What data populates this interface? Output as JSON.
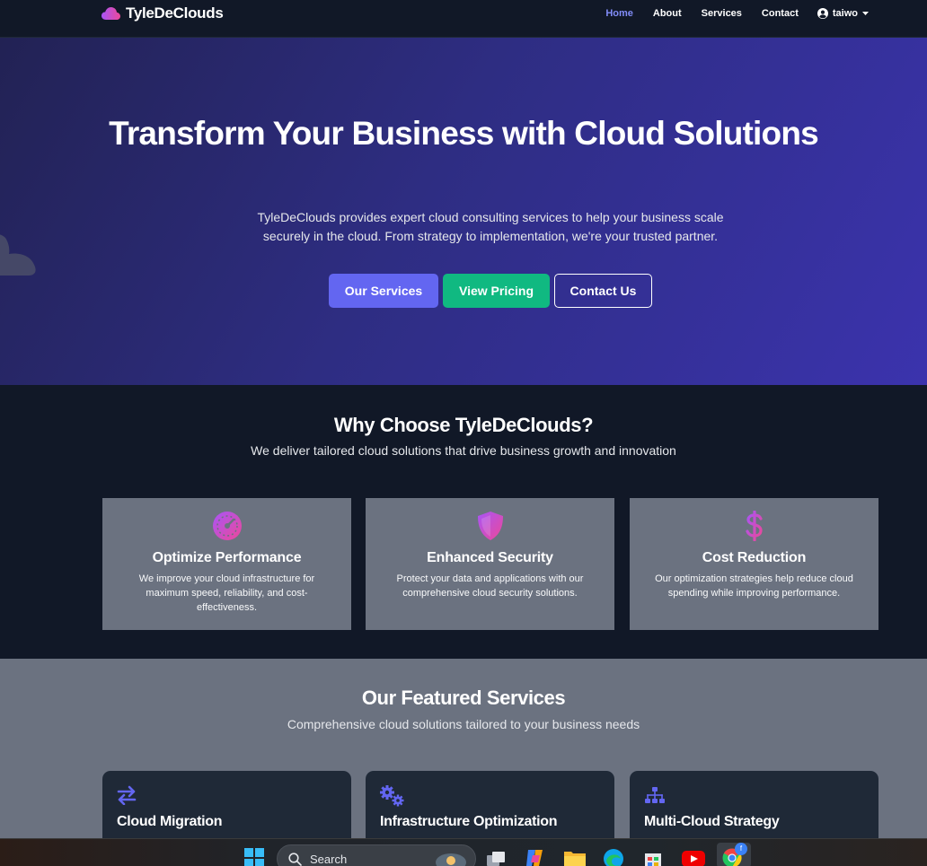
{
  "navbar": {
    "brand": "TyleDeClouds",
    "links": [
      {
        "label": "Home",
        "active": true
      },
      {
        "label": "About"
      },
      {
        "label": "Services"
      },
      {
        "label": "Contact"
      }
    ],
    "user": "taiwo"
  },
  "hero": {
    "title": "Transform Your Business with Cloud Solutions",
    "subtitle": "TyleDeClouds provides expert cloud consulting services to help your business scale securely in the cloud. From strategy to implementation, we're your trusted partner.",
    "buttons": {
      "services": "Our Services",
      "pricing": "View Pricing",
      "contact": "Contact Us"
    }
  },
  "why": {
    "title": "Why Choose TyleDeClouds?",
    "subtitle": "We deliver tailored cloud solutions that drive business growth and innovation",
    "features": [
      {
        "icon": "tachometer-icon",
        "title": "Optimize Performance",
        "desc": "We improve your cloud infrastructure for maximum speed, reliability, and cost-effectiveness."
      },
      {
        "icon": "shield-icon",
        "title": "Enhanced Security",
        "desc": "Protect your data and applications with our comprehensive cloud security solutions."
      },
      {
        "icon": "dollar-icon",
        "title": "Cost Reduction",
        "desc": "Our optimization strategies help reduce cloud spending while improving performance."
      }
    ]
  },
  "services": {
    "title": "Our Featured Services",
    "subtitle": "Comprehensive cloud solutions tailored to your business needs",
    "items": [
      {
        "icon": "exchange-icon",
        "title": "Cloud Migration"
      },
      {
        "icon": "cogs-icon",
        "title": "Infrastructure Optimization"
      },
      {
        "icon": "sitemap-icon",
        "title": "Multi-Cloud Strategy"
      }
    ]
  },
  "taskbar": {
    "search_placeholder": "Search",
    "chrome_badge": "f"
  },
  "colors": {
    "accent": "#6366f1",
    "success": "#10b981",
    "nav_active": "#818cf8",
    "icon_gradient_start": "#a855f7",
    "icon_gradient_end": "#ec4899"
  }
}
